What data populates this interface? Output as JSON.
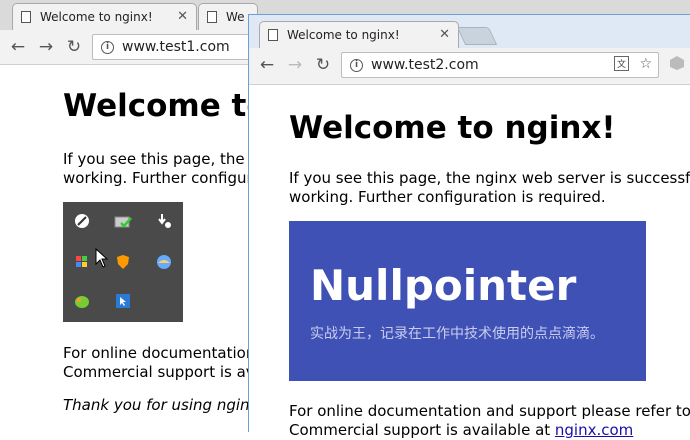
{
  "window1": {
    "tabs": [
      {
        "label": "Welcome to nginx!",
        "close": "✕"
      },
      {
        "label": "We"
      }
    ],
    "toolbar": {
      "back": "←",
      "forward": "→",
      "reload": "↻",
      "info": "i",
      "url": "www.test1.com"
    },
    "content": {
      "heading": "Welcome to",
      "p1_line1": "If you see this page, the n",
      "p1_line2": "working. Further configura",
      "p2_line1": "For online documentation",
      "p2_line2": "Commercial support is ava",
      "p3": "Thank you for using nginx"
    }
  },
  "window2": {
    "tabs": [
      {
        "label": "Welcome to nginx!",
        "close": "✕"
      }
    ],
    "toolbar": {
      "back": "←",
      "forward": "→",
      "reload": "↻",
      "info": "i",
      "url": "www.test2.com",
      "translate_icon": "translate-icon",
      "star": "☆"
    },
    "content": {
      "heading": "Welcome to nginx!",
      "p1_line1": "If you see this page, the nginx web server is successfully",
      "p1_line2": "working. Further configuration is required.",
      "banner": {
        "title": "Nullpointer",
        "subtitle": "实战为王，记录在工作中技术使用的点点滴滴。"
      },
      "p2_line1_pre": "For online documentation and support please refer to ",
      "p2_line1_link": "ng",
      "p2_line2_pre": "Commercial support is available at ",
      "p2_line2_link": "nginx.com"
    }
  },
  "colors": {
    "banner_bg": "#3f51b5",
    "link": "#1a0dab",
    "window_border": "#6aa0d8"
  }
}
